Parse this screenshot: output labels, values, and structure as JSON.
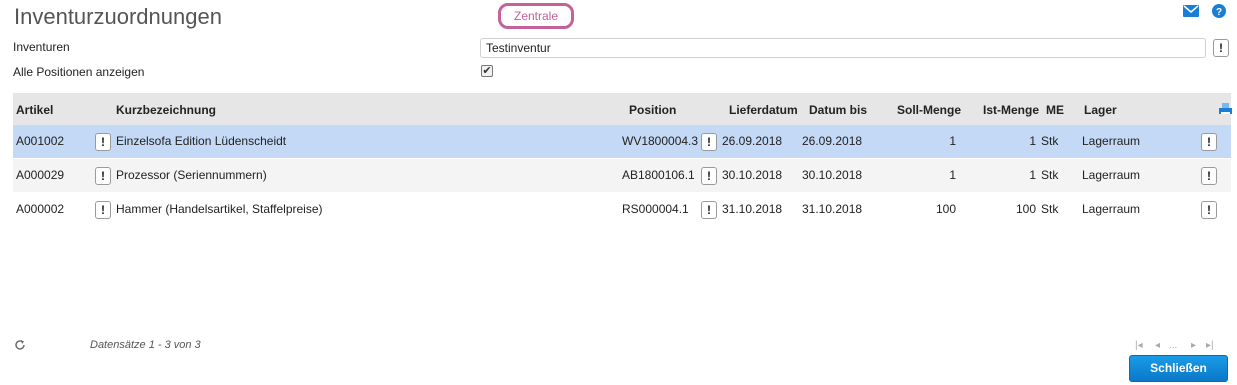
{
  "header": {
    "title": "Inventurzuordnungen",
    "badge": "Zentrale"
  },
  "form": {
    "inventuren_label": "Inventuren",
    "inventuren_value": "Testinventur",
    "show_all_label": "Alle Positionen anzeigen",
    "show_all_checked": true,
    "info_glyph": "!"
  },
  "table": {
    "columns": [
      "Artikel",
      "Kurzbezeichnung",
      "Position",
      "Lieferdatum",
      "Datum bis",
      "Soll-Menge",
      "Ist-Menge",
      "ME",
      "Lager"
    ],
    "rows": [
      {
        "artikel": "A001002",
        "kurz": "Einzelsofa Edition Lüdenscheidt",
        "position": "WV1800004.3",
        "lieferdatum": "26.09.2018",
        "datum_bis": "26.09.2018",
        "soll": "1",
        "ist": "1",
        "me": "Stk",
        "lager": "Lagerraum",
        "selected": true
      },
      {
        "artikel": "A000029",
        "kurz": "Prozessor (Seriennummern)",
        "position": "AB1800106.1",
        "lieferdatum": "30.10.2018",
        "datum_bis": "30.10.2018",
        "soll": "1",
        "ist": "1",
        "me": "Stk",
        "lager": "Lagerraum",
        "selected": false
      },
      {
        "artikel": "A000002",
        "kurz": "Hammer (Handelsartikel, Staffelpreise)",
        "position": "RS000004.1",
        "lieferdatum": "31.10.2018",
        "datum_bis": "31.10.2018",
        "soll": "100",
        "ist": "100",
        "me": "Stk",
        "lager": "Lagerraum",
        "selected": false
      }
    ]
  },
  "footer": {
    "records_text": "Datensätze 1 - 3 von 3",
    "pager_first": "|◂",
    "pager_prev": "◂",
    "pager_ellipsis": "...",
    "pager_next": "▸",
    "pager_last": "▸|",
    "close_label": "Schließen"
  },
  "colors": {
    "accent": "#c4609a",
    "selected_row": "#c4d9f5",
    "alt_row": "#f4f4f4",
    "primary_button": "#0a78c8",
    "header_bg": "#e6e6e6"
  },
  "icons": {
    "mail": "mail-icon",
    "help": "help-icon",
    "export": "export-icon",
    "refresh": "refresh-icon"
  }
}
